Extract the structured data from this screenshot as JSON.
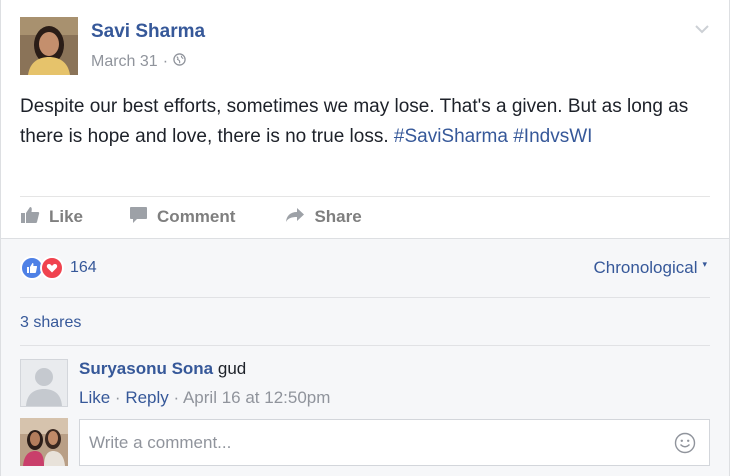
{
  "post": {
    "author": "Savi Sharma",
    "date": "March 31",
    "audience_icon": "globe-icon",
    "text_main": "Despite our best efforts, sometimes we may lose. That's a given. But as long as there is hope and love, there is no true loss.",
    "hashtags": [
      "#SaviSharma",
      "#IndvsWI"
    ],
    "actions": {
      "like": "Like",
      "comment": "Comment",
      "share": "Share"
    }
  },
  "feedback": {
    "reaction_count": "164",
    "order_label": "Chronological",
    "shares_label": "3 shares"
  },
  "comment": {
    "author": "Suryasonu Sona",
    "text": "gud",
    "like_label": "Like",
    "reply_label": "Reply",
    "timestamp": "April 16 at 12:50pm"
  },
  "composer": {
    "placeholder": "Write a comment..."
  },
  "colors": {
    "link_blue": "#365899",
    "like_blue": "#4f81e6",
    "love_red": "#f0434f",
    "muted_gray": "#90949c"
  }
}
